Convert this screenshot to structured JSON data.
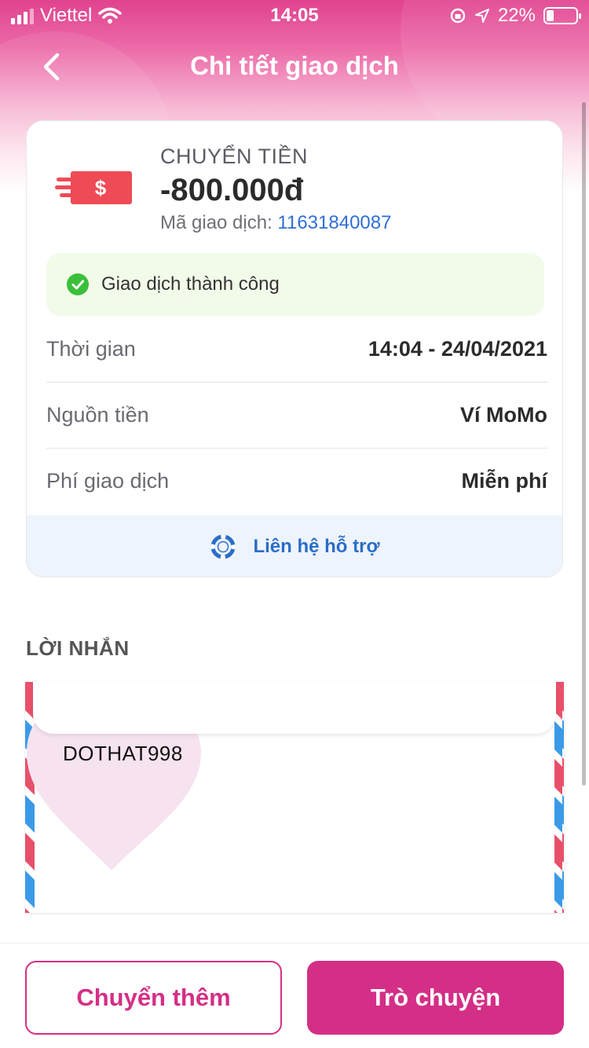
{
  "status_bar": {
    "carrier": "Viettel",
    "time": "14:05",
    "battery": "22%"
  },
  "nav": {
    "title": "Chi tiết giao dịch"
  },
  "transaction": {
    "type": "CHUYỂN TIỀN",
    "amount": "-800.000đ",
    "code_label": "Mã giao dịch:",
    "code": "11631840087",
    "status": "Giao dịch thành công",
    "rows": [
      {
        "label": "Thời gian",
        "value": "14:04 - 24/04/2021"
      },
      {
        "label": "Nguồn tiền",
        "value": "Ví MoMo"
      },
      {
        "label": "Phí giao dịch",
        "value": "Miễn phí"
      }
    ],
    "support_label": "Liên hệ hỗ trợ"
  },
  "message_section": {
    "title": "LỜI NHẮN",
    "text": "DOTHAT998"
  },
  "actions": {
    "transfer_more": "Chuyển thêm",
    "chat": "Trò chuyện"
  },
  "colors": {
    "brand": "#d42f86",
    "success": "#3bbf3b",
    "link": "#2f6fd6",
    "amount_icon": "#ee4b57"
  }
}
